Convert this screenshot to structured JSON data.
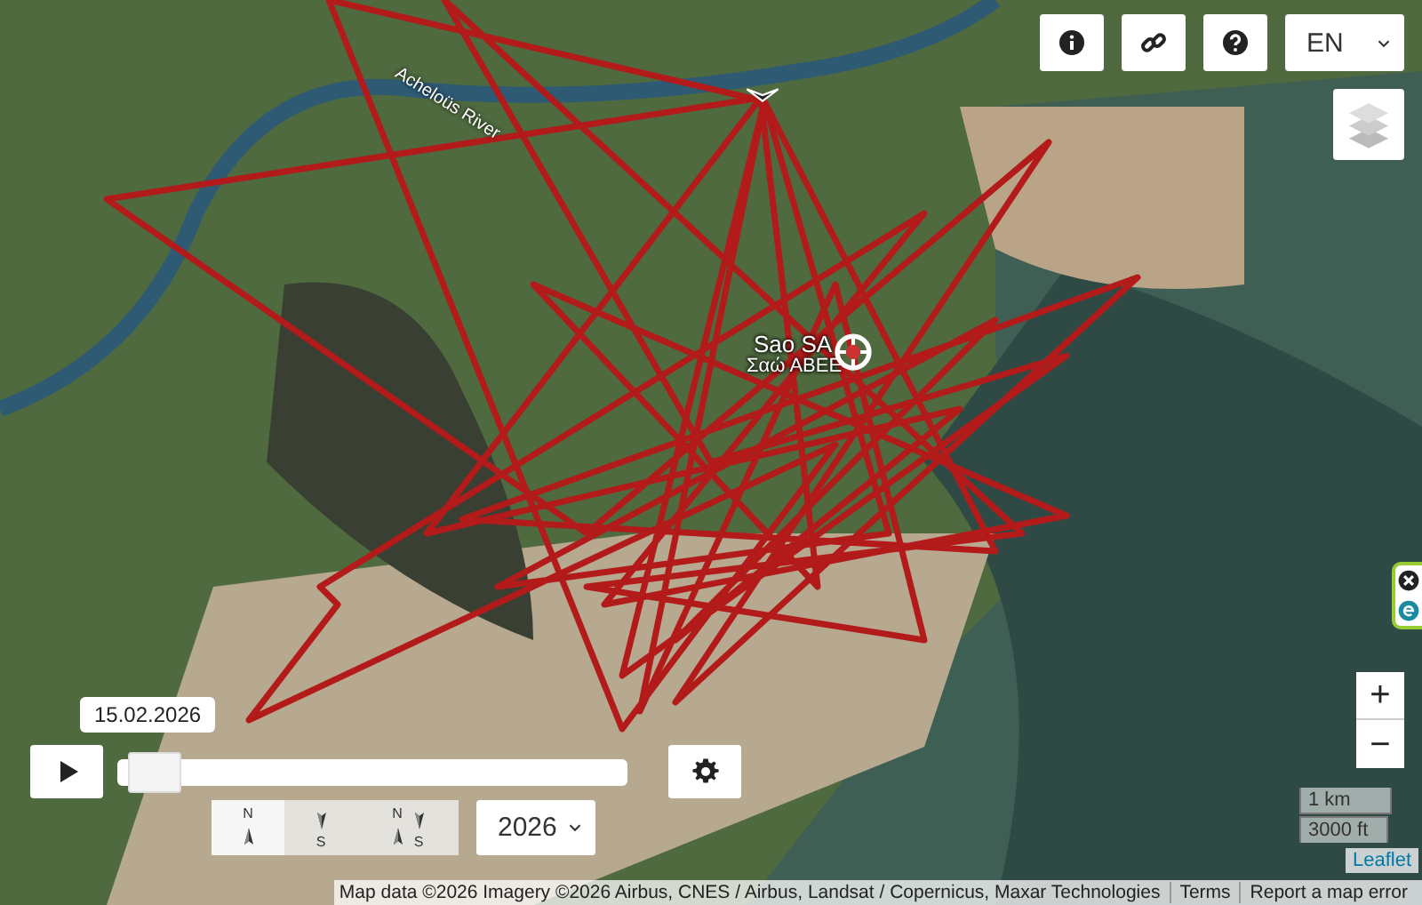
{
  "map": {
    "river_label": "Acheloüs River",
    "place": {
      "name": "Sao SA",
      "name_local": "Σαώ ΑΒΕΕ"
    }
  },
  "toolbar": {
    "buttons": [
      {
        "kind": "info"
      },
      {
        "kind": "link"
      },
      {
        "kind": "help"
      }
    ],
    "language": "EN"
  },
  "timeline": {
    "date": "15.02.2026",
    "level": 0.02
  },
  "direction_buttons": [
    {
      "kind": "north",
      "top": "N",
      "selected": true
    },
    {
      "kind": "south",
      "bottom": "S",
      "selected": false
    },
    {
      "kind": "both",
      "top": "N",
      "bottom": "S",
      "selected": false
    }
  ],
  "year": "2026",
  "zoom": {
    "in": "+",
    "out": "−"
  },
  "scale": [
    "1 km",
    "3000 ft"
  ],
  "leaflet": "Leaflet",
  "attribution": {
    "text": "Map data ©2026 Imagery ©2026 Airbus, CNES / Airbus, Landsat / Copernicus, Maxar Technologies",
    "links": [
      "Terms",
      "Report a map error"
    ]
  }
}
